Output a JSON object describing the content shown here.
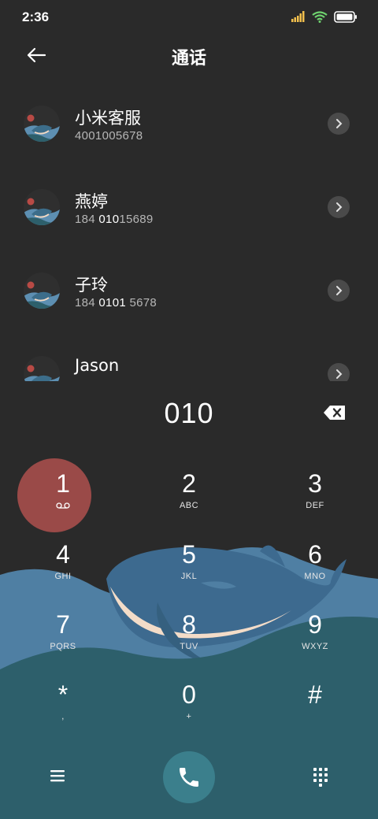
{
  "status_bar": {
    "time": "2:36"
  },
  "header": {
    "title": "通话"
  },
  "contacts": [
    {
      "name": "小米客服",
      "number_parts": [
        "400",
        "1005678"
      ],
      "number_parts_hl": [
        "",
        "",
        ""
      ],
      "number_pre": "4001005678"
    },
    {
      "name": "燕婷",
      "number_pre": "184 ",
      "number_hl": "010",
      "number_post": "15689"
    },
    {
      "name": "子玲",
      "number_pre": "184 ",
      "number_hl": "0101",
      "number_post": " 5678"
    },
    {
      "name": "Jason"
    }
  ],
  "dialer": {
    "entered_number": "010"
  },
  "keypad": [
    {
      "digit": "1",
      "letters": ""
    },
    {
      "digit": "2",
      "letters": "ABC"
    },
    {
      "digit": "3",
      "letters": "DEF"
    },
    {
      "digit": "4",
      "letters": "GHI"
    },
    {
      "digit": "5",
      "letters": "JKL"
    },
    {
      "digit": "6",
      "letters": "MNO"
    },
    {
      "digit": "7",
      "letters": "PQRS"
    },
    {
      "digit": "8",
      "letters": "TUV"
    },
    {
      "digit": "9",
      "letters": "WXYZ"
    },
    {
      "digit": "*",
      "letters": ","
    },
    {
      "digit": "0",
      "letters": "+"
    },
    {
      "digit": "#",
      "letters": ""
    }
  ],
  "colors": {
    "background": "#2a2a2a",
    "key_1_highlight": "#9a4a48",
    "call_button": "#3b7f8c",
    "wave_back": "#4f7fa3",
    "wave_front": "#2d5f6b"
  },
  "icons": {
    "back": "arrow-left-icon",
    "chevron": "chevron-right-icon",
    "backspace": "backspace-icon",
    "voicemail": "voicemail-icon",
    "menu": "menu-icon",
    "call": "phone-icon",
    "dialpad": "dialpad-icon"
  }
}
